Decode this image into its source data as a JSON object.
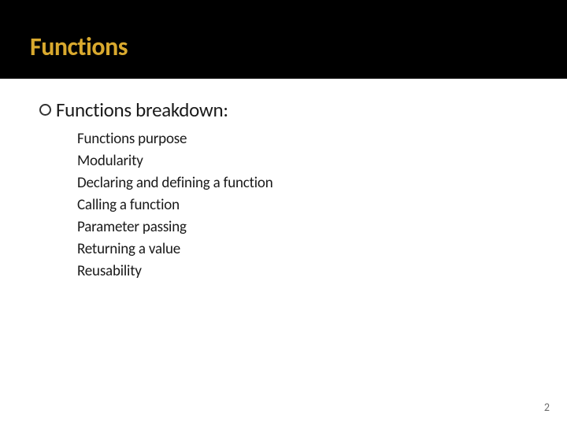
{
  "title": "Functions",
  "main_bullet": "Functions breakdown:",
  "sub_items": [
    "Functions purpose",
    "Modularity",
    "Declaring and defining a function",
    "Calling a function",
    "Parameter passing",
    "Returning a value",
    "Reusability"
  ],
  "page_number": "2"
}
